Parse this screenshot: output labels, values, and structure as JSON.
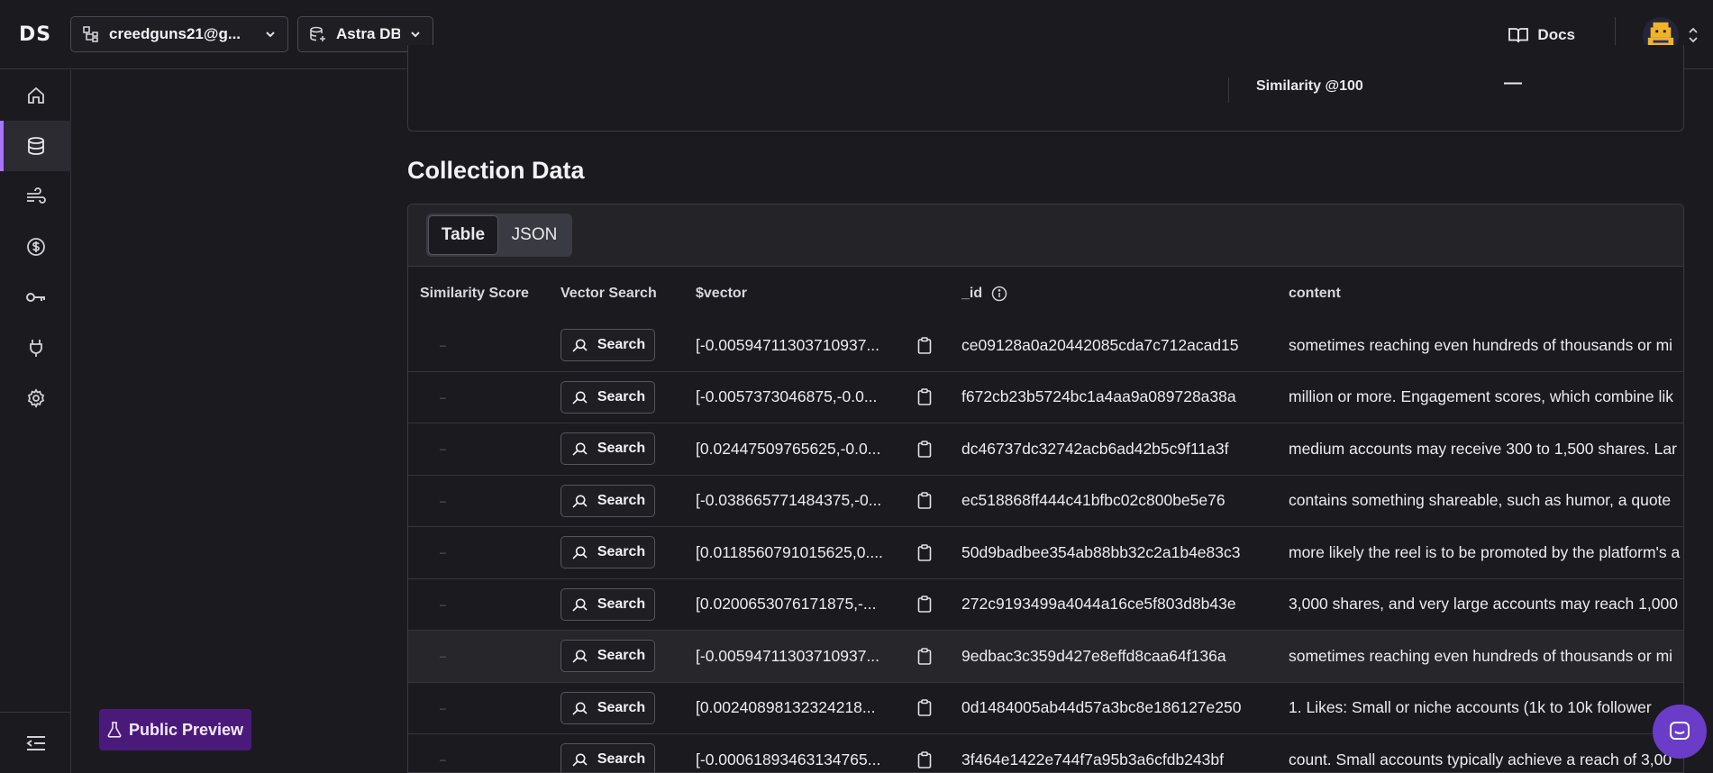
{
  "topbar": {
    "logo": "DS",
    "org_selector": "creedguns21@g...",
    "db_selector": "Astra DB",
    "docs_label": "Docs"
  },
  "preview_badge": "Public Preview",
  "metric": {
    "label": "Similarity @100",
    "value": "—"
  },
  "collection": {
    "title": "Collection Data",
    "tabs": [
      "Table",
      "JSON"
    ],
    "columns": {
      "similarity": "Similarity Score",
      "vector_search": "Vector Search",
      "vector": "$vector",
      "id": "_id",
      "content": "content"
    },
    "search_label": "Search",
    "rows": [
      {
        "sim": "–",
        "vector": "[-0.00594711303710937...",
        "id": "ce09128a0a20442085cda7c712acad15",
        "content": "sometimes reaching even hundreds of thousands or mi"
      },
      {
        "sim": "–",
        "vector": "[-0.0057373046875,-0.0...",
        "id": "f672cb23b5724bc1a4aa9a089728a38a",
        "content": "million or more. Engagement scores, which combine lik"
      },
      {
        "sim": "–",
        "vector": "[0.02447509765625,-0.0...",
        "id": "dc46737dc32742acb6ad42b5c9f11a3f",
        "content": "medium accounts may receive 300 to 1,500 shares. Lar"
      },
      {
        "sim": "–",
        "vector": "[-0.038665771484375,-0...",
        "id": "ec518868ff444c41bfbc02c800be5e76",
        "content": "contains something shareable, such as humor, a quote"
      },
      {
        "sim": "–",
        "vector": "[0.0118560791015625,0....",
        "id": "50d9badbee354ab88bb32c2a1b4e83c3",
        "content": "more likely the reel is to be promoted by the platform's a"
      },
      {
        "sim": "–",
        "vector": "[0.0200653076171875,-...",
        "id": "272c9193499a4044a16ce5f803d8b43e",
        "content": "3,000 shares, and very large accounts may reach 1,000"
      },
      {
        "sim": "–",
        "vector": "[-0.00594711303710937...",
        "id": "9edbac3c359d427e8effd8caa64f136a",
        "content": "sometimes reaching even hundreds of thousands or mi"
      },
      {
        "sim": "–",
        "vector": "[0.00240898132324218...",
        "id": "0d1484005ab44d57a3bc8e186127e250",
        "content": "1. Likes: Small or niche accounts (1k to 10k follower"
      },
      {
        "sim": "–",
        "vector": "[-0.00061893463134765...",
        "id": "3f464e1422e744f7a95b3a6cfdb243bf",
        "content": "count. Small accounts typically achieve a reach of 3,00"
      }
    ]
  }
}
